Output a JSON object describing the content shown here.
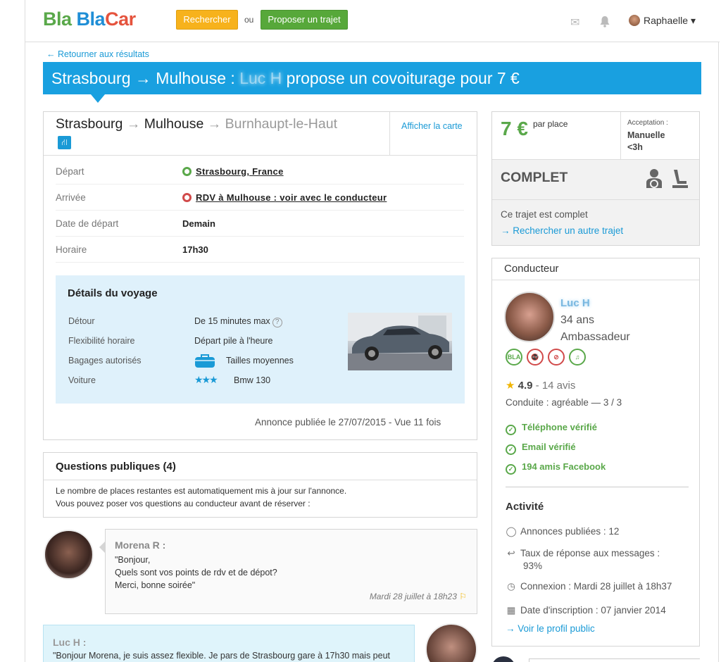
{
  "header": {
    "logo_part1": "Bla",
    "logo_part2": "Bla",
    "logo_part3": "Car",
    "search_button": "Rechercher",
    "or_text": "ou",
    "propose_button": "Proposer un trajet",
    "user_name": "Raphaelle ▾"
  },
  "back_link": "← Retourner aux résultats",
  "banner": {
    "prefix": "Strasbourg → Mulhouse : ",
    "driver": "Luc H",
    "suffix": " propose un covoiturage pour 7 €"
  },
  "route": {
    "from": "Strasbourg",
    "arrow": "→",
    "to": "Mulhouse",
    "via": "Burnhaupt-le-Haut",
    "map_link": "Afficher la carte"
  },
  "trip_rows": [
    {
      "label": "Départ",
      "value": "Strasbourg, France"
    },
    {
      "label": "Arrivée",
      "value": "RDV à Mulhouse : voir avec le conducteur"
    },
    {
      "label": "Date de départ",
      "value": "Demain"
    },
    {
      "label": "Horaire",
      "value": "17h30"
    }
  ],
  "details": {
    "title": "Détails du voyage",
    "detour_label": "Détour",
    "detour_value": "De 15 minutes max",
    "flex_label": "Flexibilité horaire",
    "flex_value": "Départ pile à l'heure",
    "bag_label": "Bagages autorisés",
    "bag_value": "Tailles moyennes",
    "car_label": "Voiture",
    "car_value": "Bmw 130",
    "car_stars": "★★★"
  },
  "posted": "Annonce publiée le 27/07/2015 - Vue 11 fois",
  "questions": {
    "title": "Questions publiques (4)",
    "line1": "Le nombre de places restantes est automatiquement mis à jour sur l'annonce.",
    "line2": "Vous pouvez poser vos questions au conducteur avant de réserver :"
  },
  "message1": {
    "name": "Morena R :",
    "l1": "\"Bonjour,",
    "l2": "Quels sont vos points de rdv et de dépot?",
    "l3": "Merci, bonne soirée\"",
    "date": "Mardi 28 juillet à 18h23"
  },
  "message2": {
    "name": "Luc H :",
    "text": "\"Bonjour Morena, je suis assez flexible. Je pars de Strasbourg gare à 17h30 mais peut"
  },
  "price": {
    "amount": "7 €",
    "per": "par place",
    "acceptance_label": "Acceptation :",
    "acceptance_value1": "Manuelle",
    "acceptance_value2": "<3h",
    "status": "COMPLET",
    "message": "Ce trajet est complet",
    "link": "→ Rechercher un autre trajet"
  },
  "driver": {
    "header": "Conducteur",
    "name": "Luc H",
    "age": "34 ans",
    "rank": "Ambassadeur",
    "rating": "4.9",
    "reviews": " - 14 avis",
    "conduite": "Conduite : agréable — 3 / 3",
    "verified": [
      "Téléphone vérifié",
      "Email vérifié",
      "194 amis Facebook"
    ],
    "activity_title": "Activité",
    "ads": "Annonces publiées : 12",
    "response_label": "Taux de réponse aux messages :",
    "response_value": "93%",
    "connexion": "Connexion : Mardi 28 juillet à 18h37",
    "inscription": "Date d'inscription : 07 janvier 2014",
    "profile_link": "→ Voir le profil public"
  },
  "colors": {
    "brand_blue": "#19a0e0",
    "green": "#5aa84a",
    "orange": "#f7b21c"
  }
}
